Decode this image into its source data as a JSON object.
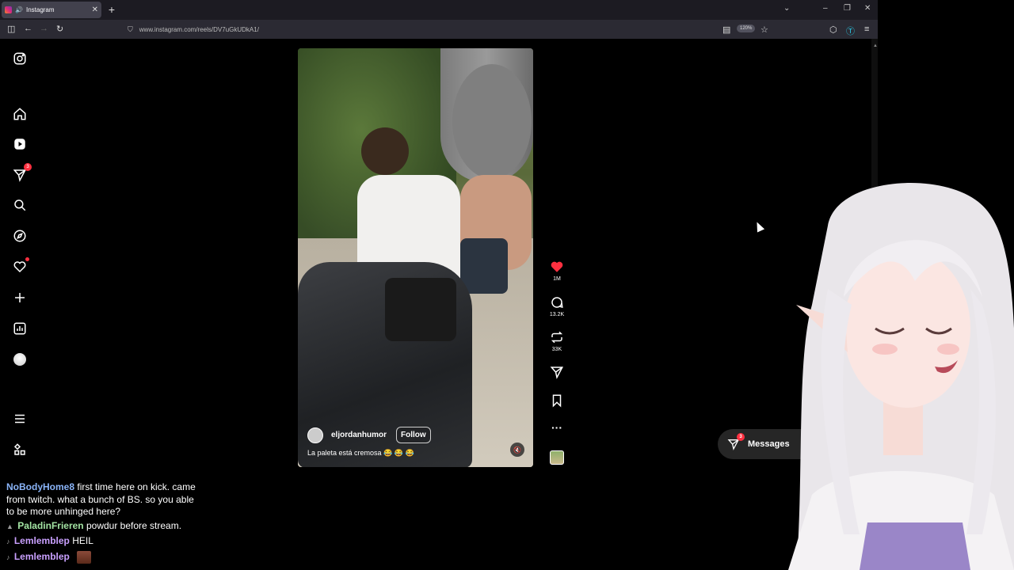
{
  "browser": {
    "tab_title": "Instagram",
    "tab_close": "✕",
    "new_tab": "+",
    "url": "www.instagram.com/reels/DV7uGkUDkA1/",
    "zoom": "120%"
  },
  "instagram": {
    "sidebar": {
      "items": [
        {
          "name": "instagram-logo-icon"
        },
        {
          "name": "home-icon"
        },
        {
          "name": "reels-icon"
        },
        {
          "name": "messages-icon",
          "badge": "3"
        },
        {
          "name": "search-icon"
        },
        {
          "name": "explore-icon"
        },
        {
          "name": "notifications-icon"
        },
        {
          "name": "create-icon"
        },
        {
          "name": "dashboard-icon"
        },
        {
          "name": "profile-avatar"
        },
        {
          "name": "more-menu-icon"
        },
        {
          "name": "also-from-meta-icon"
        }
      ]
    },
    "reel": {
      "username": "eljordanhumor",
      "follow_label": "Follow",
      "caption": "La paleta está cremosa 😂 😂 😂",
      "likes": "1M",
      "comments": "13.2K",
      "reposts": "33K"
    },
    "messages": {
      "label": "Messages",
      "badge": "3"
    }
  },
  "chat": {
    "messages": [
      {
        "user": "NoBodyHome8",
        "text": "first time here on kick. came from twitch. what a bunch of BS. so you able to be more unhinged here?",
        "color": "#8ab4f8"
      },
      {
        "user": "PaladinFrieren",
        "text": "powdur before stream.",
        "color": "#a3e4a3"
      },
      {
        "user": "Lemlemblep",
        "text": "HEIL",
        "color": "#c9a0ff"
      },
      {
        "user": "Lemlemblep",
        "text": "",
        "color": "#c9a0ff"
      }
    ]
  },
  "colors": {
    "like": "#ff3040",
    "chrome_tab": "#42414d",
    "chrome_bar": "#2b2a33"
  }
}
